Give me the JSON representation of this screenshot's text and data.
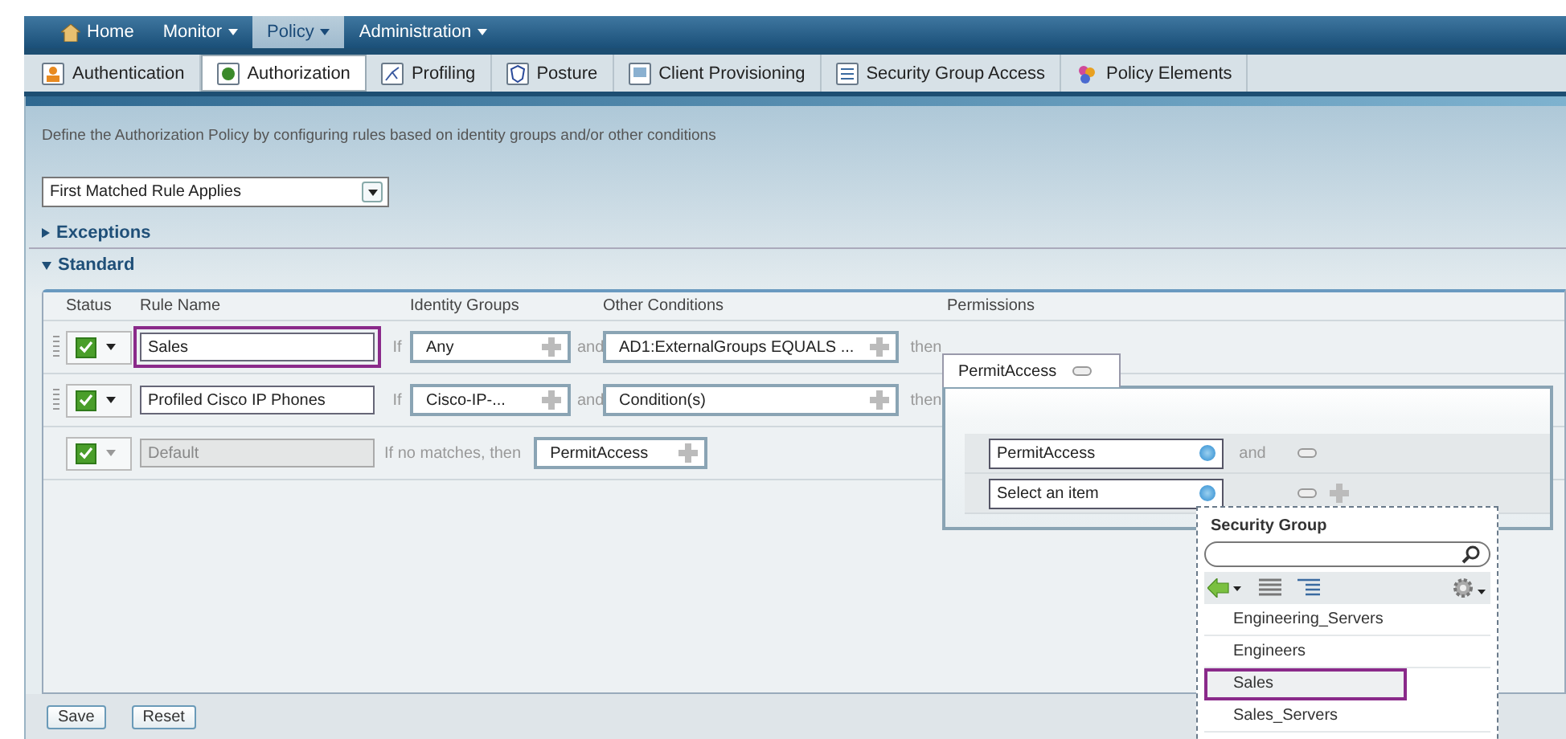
{
  "nav": [
    {
      "label": "Home",
      "selected": false,
      "dropdown": false,
      "kind": "home"
    },
    {
      "label": "Monitor",
      "selected": false,
      "dropdown": true,
      "kind": "menu"
    },
    {
      "label": "Policy",
      "selected": true,
      "dropdown": true,
      "kind": "menu"
    },
    {
      "label": "Administration",
      "selected": false,
      "dropdown": true,
      "kind": "menu"
    }
  ],
  "tabs": [
    {
      "label": "Authentication",
      "selected": false
    },
    {
      "label": "Authorization",
      "selected": true
    },
    {
      "label": "Profiling",
      "selected": false
    },
    {
      "label": "Posture",
      "selected": false
    },
    {
      "label": "Client Provisioning",
      "selected": false
    },
    {
      "label": "Security Group Access",
      "selected": false
    },
    {
      "label": "Policy Elements",
      "selected": false
    }
  ],
  "description": "Define the Authorization Policy by configuring rules based on identity groups and/or other conditions",
  "rule_mode": "First Matched Rule Applies",
  "sections": [
    {
      "label": "Exceptions",
      "expanded": false
    },
    {
      "label": "Standard",
      "expanded": true
    }
  ],
  "columns": [
    "Status",
    "Rule Name",
    "Identity Groups",
    "Other Conditions",
    "Permissions"
  ],
  "rules": [
    {
      "kind": "rule",
      "enabled": true,
      "name": "Sales",
      "highlighted": true,
      "if_label": "If",
      "identity_group": "Any",
      "and_label": "and",
      "condition": "AD1:ExternalGroups EQUALS ...",
      "then_label": "then"
    },
    {
      "kind": "rule",
      "enabled": true,
      "name": "Profiled Cisco IP Phones",
      "highlighted": false,
      "if_label": "If",
      "identity_group": "Cisco-IP-...",
      "and_label": "and",
      "condition": "Condition(s)",
      "then_label": "then"
    },
    {
      "kind": "default",
      "enabled": true,
      "name": "Default",
      "highlighted": false,
      "no_match_label": "If no matches, then",
      "permission": "PermitAccess"
    }
  ],
  "permissions_editor": {
    "tab_label": "PermitAccess",
    "rows": [
      {
        "value": "PermitAccess",
        "and_label": "and",
        "can_add": false
      },
      {
        "placeholder": "Select an item",
        "can_add": true
      }
    ]
  },
  "security_group_list": {
    "title": "Security Group",
    "items": [
      {
        "label": "Engineering_Servers",
        "selected": false
      },
      {
        "label": "Engineers",
        "selected": false
      },
      {
        "label": "Sales",
        "selected": true
      },
      {
        "label": "Sales_Servers",
        "selected": false
      }
    ]
  },
  "buttons": [
    "Save",
    "Reset"
  ]
}
